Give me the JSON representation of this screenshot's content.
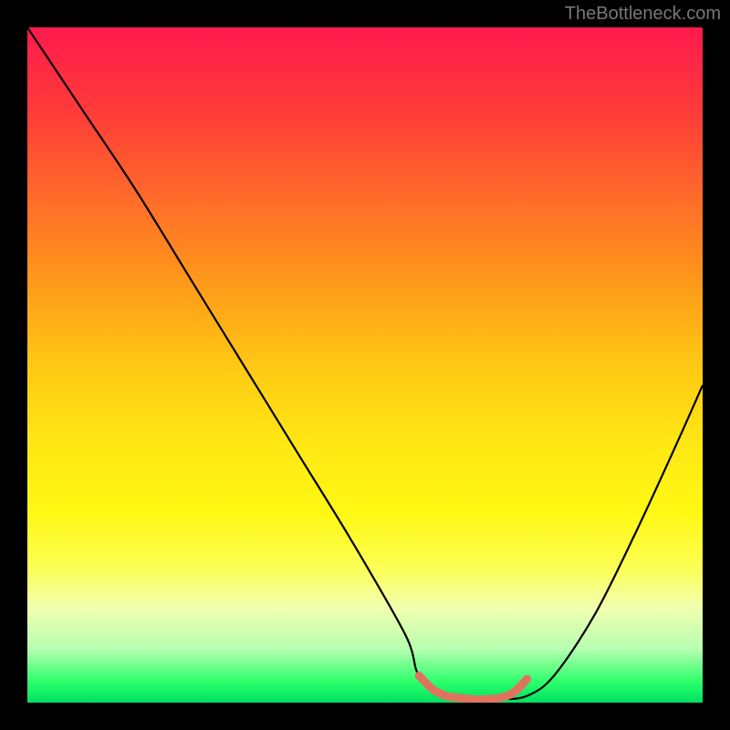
{
  "watermark": "TheBottleneck.com",
  "chart_data": {
    "type": "line",
    "title": "",
    "xlabel": "",
    "ylabel": "",
    "xlim": [
      0,
      100
    ],
    "ylim": [
      0,
      100
    ],
    "series": [
      {
        "name": "curve",
        "x": [
          0,
          8,
          16,
          24,
          32,
          40,
          48,
          56,
          58,
          62,
          66,
          70,
          74,
          78,
          84,
          90,
          96,
          100
        ],
        "y": [
          100,
          88,
          76,
          63,
          50,
          37,
          24,
          10,
          4,
          1,
          0.5,
          0.5,
          1,
          4,
          13,
          25,
          38,
          47
        ]
      },
      {
        "name": "highlight",
        "x": [
          58,
          60,
          62,
          64,
          66,
          68,
          70,
          72,
          74
        ],
        "y": [
          4,
          2,
          1,
          0.7,
          0.5,
          0.5,
          0.7,
          1.5,
          3.5
        ]
      }
    ],
    "gradient_bg": {
      "orientation": "vertical",
      "stops": [
        {
          "pos": 0.0,
          "color": "#ff1a4d"
        },
        {
          "pos": 0.5,
          "color": "#ffc814"
        },
        {
          "pos": 0.8,
          "color": "#fcff55"
        },
        {
          "pos": 1.0,
          "color": "#00e060"
        }
      ]
    },
    "highlight_color": "#e0735f"
  }
}
